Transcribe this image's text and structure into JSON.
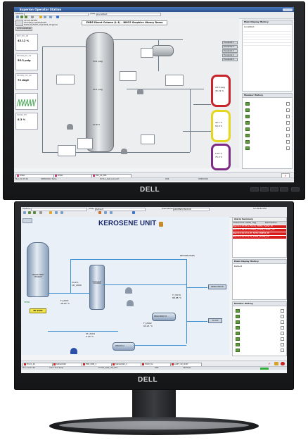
{
  "monitor1": {
    "window_title": "Experion Operator Station",
    "toolbar": {
      "module_label": "Module:",
      "view_label": "View:",
      "view_value": "LocalRoot"
    },
    "header": {
      "time": "12:05:39 PM",
      "date": "Thursday 05/13/2010",
      "station": "Default_FACE_Oper001_Original",
      "acknowledge_button": "Acknowledge",
      "silence_button": "Silence"
    },
    "title": "EHRS Direct Column (L-1) – NMCS Graphics Library Demo",
    "right_buttons": [
      "Faceplate 1",
      "Faceplate 2",
      "Faceplate 3",
      "Faceplate 4",
      "Faceplate 5"
    ],
    "trend_tiles": [
      {
        "label": "PCT_PV_02",
        "value": "45.12 %"
      },
      {
        "label": "PCTAN_PV_02",
        "value": "55.3 psig"
      },
      {
        "label": "PCTAN_CH_02",
        "value": "72 degC"
      },
      {
        "label": "FLOW_PV",
        "value": "8.3 %"
      }
    ],
    "tank_labels": [
      {
        "value": "18.5 psig",
        "sub": "45.21 %"
      },
      {
        "value": "42.1 %",
        "sub": "50.0 %"
      },
      {
        "value": "5.07 %",
        "sub": "75.3 %"
      }
    ],
    "column_labels": [
      "34.1 psig",
      "50.1 psig",
      "37.8 %"
    ],
    "main_display_history": {
      "title": "Main Display History",
      "first_item": "LocalRoot"
    },
    "member_history": {
      "title": "Member History"
    },
    "alarm_chips": [
      {
        "label": "LTRAL",
        "color": "#d23a7a"
      },
      {
        "label": "LTRAL",
        "color": "#d23a7a"
      },
      {
        "label": "FRC_04_REL",
        "color": "#d23a7a"
      }
    ],
    "status": {
      "time": "Mon 11:05:39",
      "operator": "OPERATOR: Temp",
      "point": "PC710_AGR_LIN_A2H",
      "mode": "OPR",
      "security": "OPERATOR"
    },
    "brand": "DELL",
    "colors": {
      "tank1": "#c9242c",
      "tank2": "#e6d61e",
      "tank3": "#7d2b86"
    }
  },
  "monitor2": {
    "toolbar": {
      "module_label": "Module:",
      "view_label": "View:",
      "view_value": "Default",
      "operator_label": "Username:",
      "operator_value": "ADMINISTRATOR",
      "clock": "12:09:40 PM"
    },
    "title": "KEROSENE UNIT",
    "equipment": [
      {
        "name": "kerosene-stripper",
        "label": "KEROSENE STRIPPER"
      },
      {
        "name": "feed-tank",
        "label": "CRUDE FEED CHARGE"
      },
      {
        "name": "kero-prod-exchanger",
        "label": "KERO PROD EX"
      },
      {
        "name": "kero-exchanger-2",
        "label": "KERO EX 2"
      }
    ],
    "process_labels": [
      {
        "text": "54.2%",
        "sub": "LIC_2000"
      },
      {
        "text": "FI_2001",
        "sub": "38.00 °C"
      },
      {
        "text": "FI_2002",
        "sub": "64.21 °C"
      },
      {
        "text": "TI_5070",
        "sub": "88.88 °C"
      },
      {
        "text": "ST_2004",
        "sub": "5.29 °C"
      },
      {
        "text": "KERO PROD",
        "sub": "TO STORAGE"
      },
      {
        "text": "TO PIT",
        "sub": ""
      },
      {
        "text": "RETURN PARS",
        "sub": ""
      },
      {
        "text": "TK 2031",
        "sub": "RTP TT5_1101"
      }
    ],
    "feed_label": "Feed",
    "alarm_summary": {
      "title": "Alarm Summary",
      "columns": [
        "Date/Time",
        "State",
        "Tag",
        "Description"
      ],
      "rows": [
        "Wed 12:37:55  L  FIC21_FEED_FLOW_HI",
        "Wed 12:38:40  U  KERO_STRIP_LEVEL_LO",
        "Wed 12:41:13  L  PI_5070_PRESS_HI",
        "Wed 12:41:13  L  FI_2002_FLOW_LO"
      ]
    },
    "main_display_history": {
      "title": "Main Display History",
      "first_item": "Default"
    },
    "member_history": {
      "title": "Member History"
    },
    "alarm_chips": [
      {
        "label": "FIC21_40",
        "color": "#d02828"
      },
      {
        "label": "SWSL0020",
        "color": "#d02828"
      },
      {
        "label": "FRB_CMB_2",
        "color": "#d02828"
      },
      {
        "label": "SWSL0020_2",
        "color": "#d02828"
      },
      {
        "label": "HIGH_SV",
        "color": "#d02828"
      },
      {
        "label": "ADPT_40_RUST",
        "color": "#d02828"
      }
    ],
    "status": {
      "time": "Mon 12:07:40",
      "operator": "Clark 311 Temp",
      "point": "PC710_AGR_LIN_A2H",
      "mode": "OPR",
      "security": "CRITICAL"
    },
    "brand": "DELL"
  }
}
